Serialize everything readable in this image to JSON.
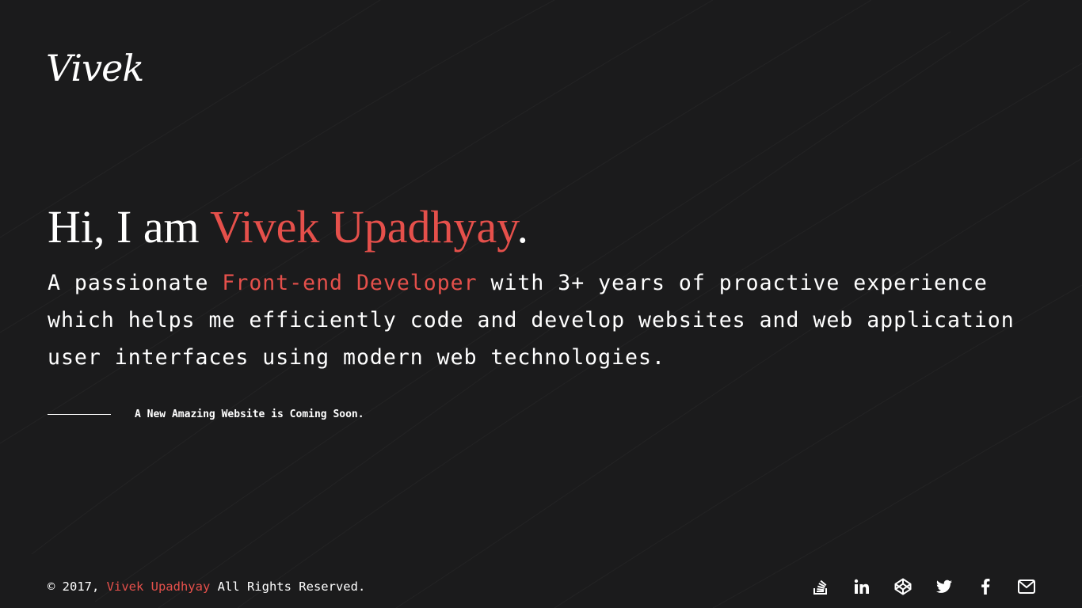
{
  "logo": {
    "text": "Vivek"
  },
  "hero": {
    "greeting": "Hi, I am ",
    "name": "Vivek Upadhyay",
    "period": "."
  },
  "intro": {
    "prefix": "A passionate ",
    "role": "Front-end Developer",
    "suffix": " with 3+ years of proactive experience which helps me efficiently code and develop websites and web application user interfaces using modern web technologies."
  },
  "coming_soon": {
    "text": "A New Amazing Website is Coming Soon."
  },
  "footer": {
    "copy_prefix": "© 2017, ",
    "copy_name": "Vivek Upadhyay",
    "copy_suffix": " All Rights Reserved."
  },
  "social": {
    "icons": [
      "stack-overflow-icon",
      "linkedin-icon",
      "codepen-icon",
      "twitter-icon",
      "facebook-icon",
      "mail-icon"
    ]
  },
  "colors": {
    "background": "#1b1b1c",
    "accent": "#e5504b",
    "text": "#ffffff"
  }
}
